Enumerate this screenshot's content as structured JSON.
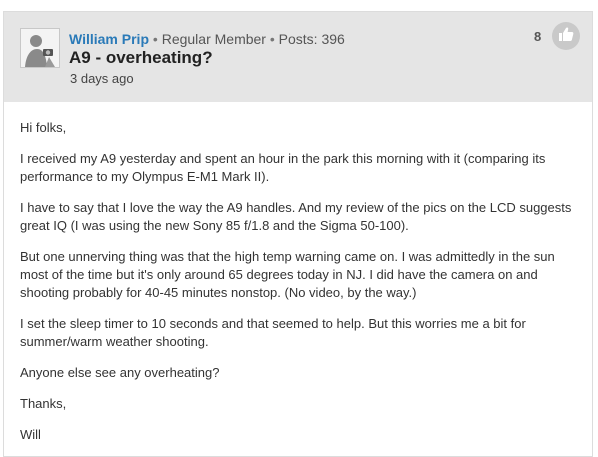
{
  "post": {
    "author": "William Prip",
    "separator": "•",
    "rank": "Regular Member",
    "posts_label": "Posts: 396",
    "title": "A9 - overheating?",
    "time": "3 days ago",
    "like_count": "8",
    "like_icon": "thumbs-up-icon",
    "avatar_icon": "user-avatar-icon",
    "body": [
      "Hi folks,",
      "I received my A9 yesterday and spent an hour in the park this morning with it (comparing its performance to my Olympus E-M1 Mark II).",
      "I have to say that I love the way the A9 handles. And my review of the pics on the LCD suggests great IQ (I was using the new Sony 85 f/1.8 and the Sigma 50-100).",
      "But one unnerving thing was that the high temp warning came on. I was admittedly in the sun most of the time but it's only around 65 degrees today in NJ. I did have the camera on and shooting probably for 40-45 minutes nonstop. (No video, by the way.)",
      "I set the sleep timer to 10 seconds and that seemed to help. But this worries me a bit for summer/warm weather shooting.",
      "Anyone else see any overheating?",
      "Thanks,",
      "Will"
    ]
  },
  "colors": {
    "header_bg": "#e5e5e5",
    "author_link": "#2a7ab8",
    "like_button_bg": "#c9c9c9"
  }
}
